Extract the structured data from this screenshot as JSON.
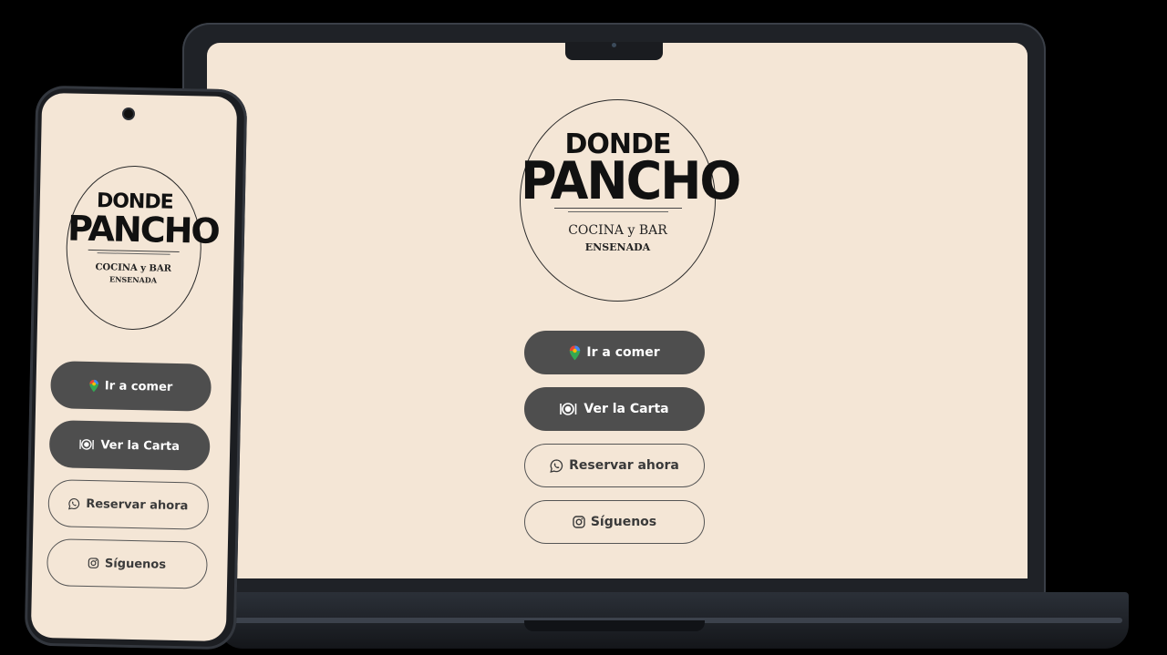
{
  "brand": {
    "line1": "DONDE",
    "line2": "PANCHO",
    "line3": "COCINA y BAR",
    "line4": "ENSENADA"
  },
  "buttons": {
    "ir_a_comer": "Ir a comer",
    "ver_la_carta": "Ver la Carta",
    "reservar_ahora": "Reservar ahora",
    "siguenos": "Síguenos"
  },
  "icons": {
    "ir_a_comer": "map-pin-icon",
    "ver_la_carta": "plate-cutlery-icon",
    "reservar_ahora": "whatsapp-icon",
    "siguenos": "instagram-icon"
  },
  "colors": {
    "screen_bg": "#f4e6d6",
    "dark_button": "#4e4e4e",
    "device_frame": "#1f2227"
  }
}
